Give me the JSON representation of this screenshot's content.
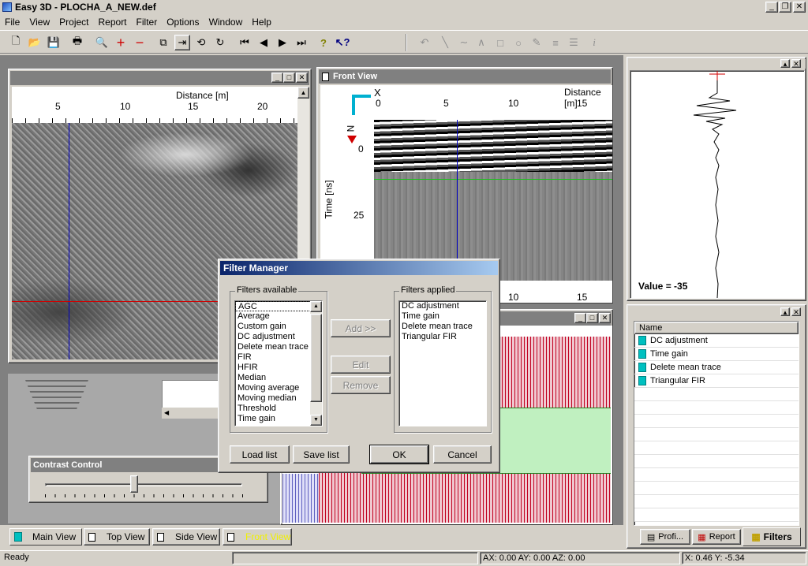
{
  "window": {
    "title": "Easy 3D - PLOCHA_A_NEW.def"
  },
  "menu": [
    "File",
    "View",
    "Project",
    "Report",
    "Filter",
    "Options",
    "Window",
    "Help"
  ],
  "top_view": {
    "axis_title": "Distance [m]",
    "ticks": [
      "5",
      "10",
      "15",
      "20"
    ]
  },
  "front_view": {
    "title": "Front View",
    "axis_title": "Distance [m]",
    "x_ticks": [
      "0",
      "5",
      "10",
      "15"
    ],
    "y_label": "Time [ns]",
    "y_ticks": [
      "0",
      "25"
    ],
    "axis_x": "X",
    "axis_n": "N",
    "bottom_ticks": [
      "10",
      "15"
    ]
  },
  "trace": {
    "value_label": "Value = -35"
  },
  "filters_panel": {
    "header": "Name",
    "items": [
      "DC adjustment",
      "Time gain",
      "Delete mean trace",
      "Triangular FIR"
    ]
  },
  "contrast": {
    "title": "Contrast Control",
    "level": 0.45
  },
  "dialog": {
    "title": "Filter Manager",
    "available_label": "Filters available",
    "applied_label": "Filters applied",
    "available": [
      "AGC",
      "Average",
      "Custom gain",
      "DC adjustment",
      "Delete mean trace",
      "FIR",
      "HFIR",
      "Median",
      "Moving average",
      "Moving median",
      "Threshold",
      "Time gain"
    ],
    "applied": [
      "DC adjustment",
      "Time gain",
      "Delete mean trace",
      "Triangular FIR"
    ],
    "add": "Add >>",
    "edit": "Edit",
    "remove": "Remove",
    "load": "Load list",
    "save": "Save list",
    "ok": "OK",
    "cancel": "Cancel"
  },
  "tabs": [
    "Main View",
    "Top View",
    "Side View",
    "Front View"
  ],
  "panel_tabs": [
    "Profi...",
    "Report",
    "Filters"
  ],
  "status": {
    "ready": "Ready",
    "axes": "AX:  0.00    AY:  0.00    AZ:  0.00",
    "xy": "X:  0.46   Y: -5.34"
  }
}
